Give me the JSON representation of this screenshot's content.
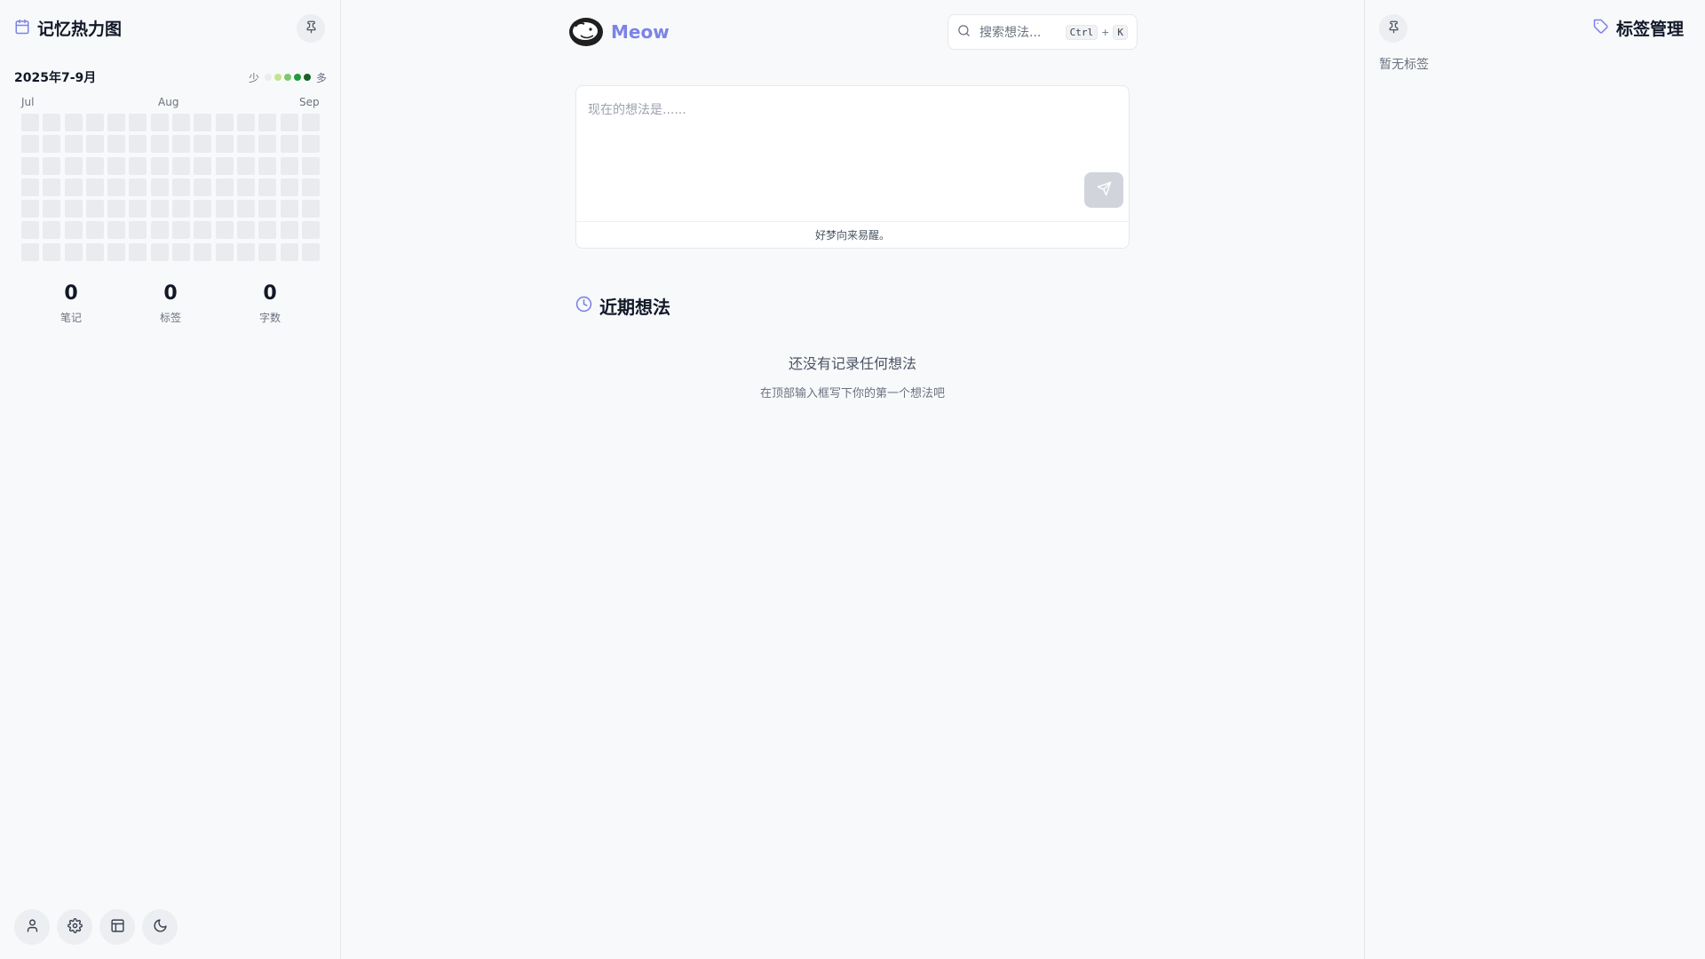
{
  "left_sidebar": {
    "title": "记忆热力图",
    "title_icon": "calendar-icon",
    "pin_icon": "pin-icon",
    "range_label": "2025年7-9月",
    "legend": {
      "less": "少",
      "more": "多",
      "colors": [
        "#ebedf0",
        "#c6e48b",
        "#7bc96f",
        "#239a3b",
        "#196127"
      ]
    },
    "months": [
      "Jul",
      "Aug",
      "Sep"
    ],
    "heatmap": {
      "columns": 14,
      "rows": 7,
      "levels": []
    },
    "stats": [
      {
        "value": "0",
        "label": "笔记"
      },
      {
        "value": "0",
        "label": "标签"
      },
      {
        "value": "0",
        "label": "字数"
      }
    ],
    "bottom_buttons": [
      "user-icon",
      "gear-icon",
      "layout-icon",
      "moon-icon"
    ]
  },
  "center": {
    "brand": "Meow",
    "search": {
      "placeholder": "搜索想法...",
      "shortcut_ctrl": "Ctrl",
      "shortcut_plus": "+",
      "shortcut_key": "K"
    },
    "composer": {
      "placeholder": "现在的想法是......",
      "footer_quote": "好梦向来易醒。"
    },
    "recent": {
      "title": "近期想法",
      "empty_title": "还没有记录任何想法",
      "empty_hint": "在顶部输入框写下你的第一个想法吧"
    }
  },
  "right_sidebar": {
    "title": "标签管理",
    "title_icon": "tag-icon",
    "empty_text": "暂无标签"
  },
  "colors": {
    "accent": "#7c83e6",
    "text_dark": "#111827",
    "text_muted": "#6b7280"
  }
}
